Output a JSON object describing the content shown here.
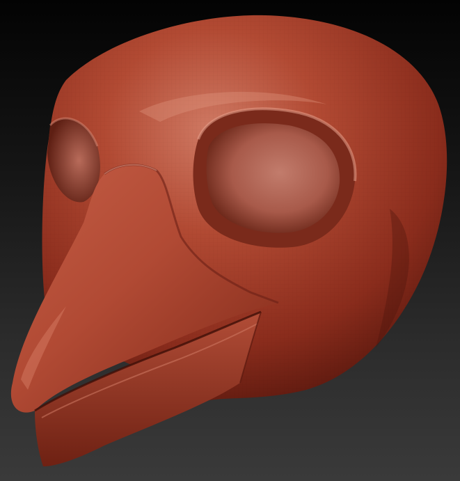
{
  "scene": {
    "subject": "bird-head-sculpt",
    "parts": [
      "head",
      "eye-socket-right",
      "eye-socket-left",
      "upper-beak",
      "lower-beak"
    ]
  },
  "colors": {
    "background_top": "#030303",
    "background_bottom": "#3a3a3a",
    "clay_base": "#a8412c",
    "clay_highlight": "#d9826c",
    "clay_shadow": "#4a130b",
    "eye_socket_inner": "#b0685a"
  }
}
